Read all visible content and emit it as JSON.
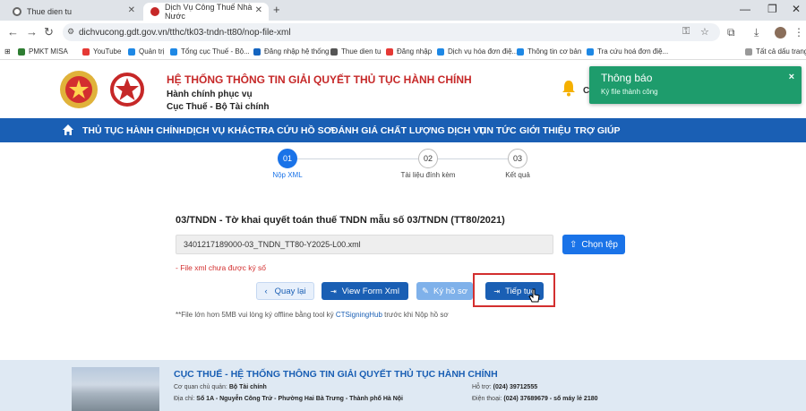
{
  "browser": {
    "tabs": [
      {
        "title": "Thue dien tu"
      },
      {
        "title": "Dịch Vụ Công Thuế Nhà Nước"
      }
    ],
    "url": "dichvucong.gdt.gov.vn/tthc/tk03-tndn-tt80/nop-file-xml",
    "bookmarks": [
      "PMKT MISA",
      "YouTube",
      "Quản trị",
      "Tổng cục Thuế - Bộ...",
      "Đăng nhập hệ thống",
      "Thue dien tu",
      "Đăng nhập",
      "Dịch vụ hóa đơn điệ...",
      "Thông tin cơ bản",
      "Tra cứu hoá đơn điệ..."
    ],
    "all_bookmarks": "Tất cả dấu trang"
  },
  "header": {
    "title": "HỆ THỐNG THÔNG TIN GIẢI QUYẾT THỦ TỤC HÀNH CHÍNH",
    "sub1": "Hành chính phục vụ",
    "sub2": "Cục Thuế - Bộ Tài chính",
    "partial": "C"
  },
  "toast": {
    "title": "Thông báo",
    "message": "Ký file thành công",
    "close": "×",
    "color": "#1e9c6c"
  },
  "menu": [
    "THỦ TỤC HÀNH CHÍNH",
    "DỊCH VỤ KHÁC",
    "TRA CỨU HỒ SƠ",
    "ĐÁNH GIÁ CHẤT LƯỢNG DỊCH VỤ",
    "TIN TỨC",
    "GIỚI THIỆU",
    "TRỢ GIÚP"
  ],
  "steps": [
    {
      "num": "01",
      "label": "Nộp XML",
      "active": true
    },
    {
      "num": "02",
      "label": "Tài liệu đính kèm",
      "active": false
    },
    {
      "num": "03",
      "label": "Kết quả",
      "active": false
    }
  ],
  "form": {
    "title": "03/TNDN - Tờ khai quyết toán thuế TNDN mẫu số 03/TNDN (TT80/2021)",
    "file_name": "3401217189000-03_TNDN_TT80-Y2025-L00.xml",
    "choose_label": "Chọn tệp",
    "error": "- File xml chưa được ký số",
    "back_label": "Quay lại",
    "view_label": "View Form Xml",
    "sign_label": "Ký hồ sơ",
    "next_label": "Tiếp tục",
    "note_prefix": "**File lớn hơn 5MB vui lòng ký offline bằng tool ký ",
    "note_link": "CTSigningHub",
    "note_suffix": " trước khi Nộp hồ sơ"
  },
  "footer": {
    "title": "CỤC THUẾ - HỆ THỐNG THÔNG TIN GIẢI QUYẾT THỦ TỤC HÀNH CHÍNH",
    "agency_label": "Cơ quan chủ quản:",
    "agency": "Bộ Tài chính",
    "address_label": "Địa chỉ:",
    "address": "Số 1A - Nguyễn Công Trứ - Phường Hai Bà Trưng - Thành phố Hà Nội",
    "support_label": "Hỗ trợ:",
    "support": "(024) 39712555",
    "phone_label": "Điện thoại:",
    "phone": "(024) 37689679 - số máy lẻ 2180"
  },
  "colors": {
    "primary": "#1a5fb4",
    "accent_red": "#c62828",
    "button_blue": "#1a73e8"
  }
}
